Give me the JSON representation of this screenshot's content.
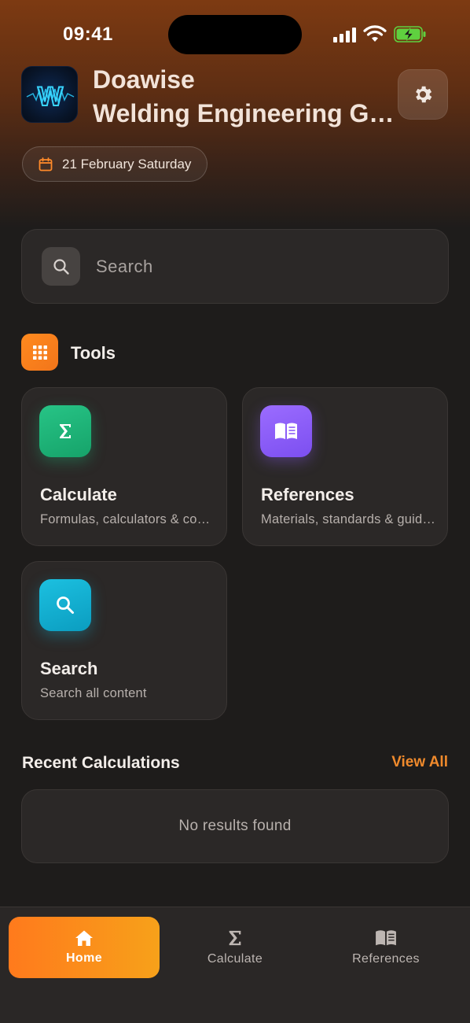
{
  "status_bar": {
    "time": "09:41"
  },
  "header": {
    "title_line1": "Doawise",
    "title_line2": "Welding Engineering Guide",
    "logo_letter": "W",
    "date": "21 February Saturday"
  },
  "search": {
    "placeholder": "Search"
  },
  "tools": {
    "title": "Tools",
    "cards": [
      {
        "title": "Calculate",
        "subtitle": "Formulas, calculators & conversions",
        "icon": "sigma-icon",
        "color": "#1fb579"
      },
      {
        "title": "References",
        "subtitle": "Materials, standards & guides",
        "icon": "book-icon",
        "color": "#8b5cf6"
      },
      {
        "title": "Search",
        "subtitle": "Search all content",
        "icon": "search-icon",
        "color": "#13b0d0"
      }
    ]
  },
  "recent": {
    "title": "Recent Calculations",
    "view_all": "View All",
    "empty_text": "No results found"
  },
  "tab_bar": {
    "tabs": [
      {
        "label": "Home",
        "icon": "home-icon",
        "active": true
      },
      {
        "label": "Calculate",
        "icon": "sigma-icon",
        "active": false
      },
      {
        "label": "References",
        "icon": "book-icon",
        "active": false
      }
    ]
  },
  "colors": {
    "accent": "#f08a2c",
    "background": "#1e1c1b",
    "card": "#2b2827"
  }
}
